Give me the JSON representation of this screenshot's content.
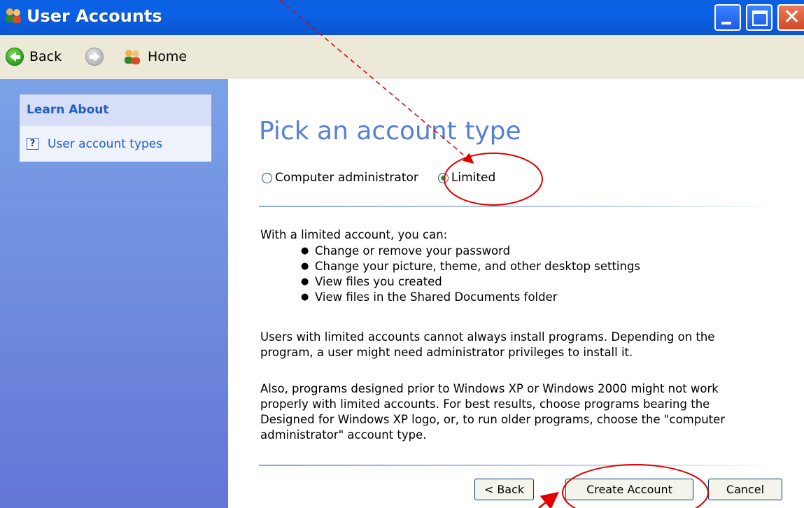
{
  "window": {
    "title": "User Accounts",
    "icon": "users-icon",
    "buttons": [
      "minimize-icon",
      "maximize-icon",
      "close-icon"
    ]
  },
  "toolbar": {
    "back_label": "Back",
    "forward_icon": "forward-arrow-icon",
    "home_label": "Home"
  },
  "sidebar": {
    "heading": "Learn About",
    "items": [
      {
        "label": "User account types",
        "icon": "help-icon"
      }
    ]
  },
  "main": {
    "title": "Pick an account type",
    "radio_options": [
      {
        "label": "Computer administrator",
        "checked": false
      },
      {
        "label": "Limited",
        "checked": true
      }
    ],
    "intro": "With a limited account, you can:",
    "bullets": [
      "Change or remove your password",
      "Change your picture, theme, and other desktop settings",
      "View files you created",
      "View files in the Shared Documents folder"
    ],
    "paragraph2": "Users with limited accounts cannot always install programs. Depending on the program, a user might need administrator privileges to install it.",
    "paragraph3": "Also, programs designed prior to Windows XP or Windows 2000 might not work properly with limited accounts. For best results, choose programs bearing the Designed for Windows XP logo, or, to run older programs, choose the \"computer administrator\" account type.",
    "buttons": {
      "back": "< Back",
      "create": "Create Account",
      "cancel": "Cancel"
    }
  },
  "colors": {
    "titlebar": "#0b61e6",
    "sidebar": "#7ba2e7",
    "title_text": "#5680d6",
    "annotation": "#e00000"
  }
}
